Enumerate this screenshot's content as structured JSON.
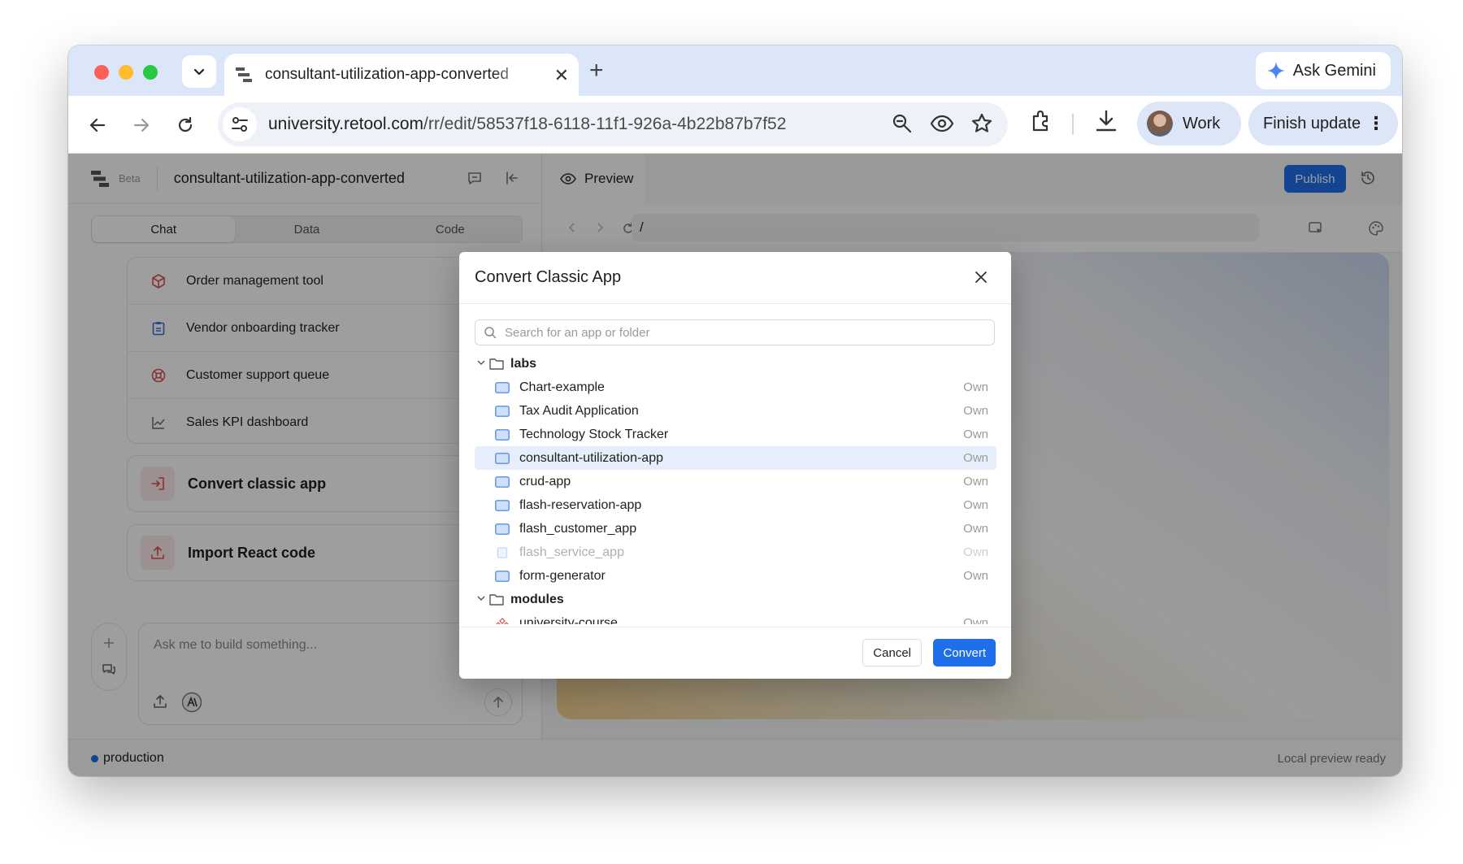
{
  "browser": {
    "tab_title": "consultant-utilization-app-converted",
    "tab_close": "✕",
    "new_tab": "+",
    "ask_gemini": "Ask Gemini",
    "url_host": "university.retool.com",
    "url_path": "/rr/edit/58537f18-6118-11f1-926a-4b22b87b7f52",
    "profile_label": "Work",
    "finish_update": "Finish update",
    "menu_dots": "⋮"
  },
  "app": {
    "beta": "Beta",
    "name": "consultant-utilization-app-converted",
    "tabs": [
      {
        "label": "Chat"
      },
      {
        "label": "Data"
      },
      {
        "label": "Code"
      }
    ],
    "templates": [
      {
        "label": "Order management tool",
        "icon": "cube-icon"
      },
      {
        "label": "Vendor onboarding tracker",
        "icon": "clipboard-icon"
      },
      {
        "label": "Customer support queue",
        "icon": "lifebuoy-icon"
      },
      {
        "label": "Sales KPI dashboard",
        "icon": "chart-line-icon"
      }
    ],
    "actions": [
      {
        "label": "Convert classic app",
        "icon": "import-icon"
      },
      {
        "label": "Import React code",
        "icon": "upload-icon"
      }
    ],
    "chat_placeholder": "Ask me to build something...",
    "preview_label": "Preview",
    "publish": "Publish",
    "preview_path": "/",
    "environment": "production",
    "status": "Local preview ready",
    "accent": "#1f6feb"
  },
  "modal": {
    "title": "Convert Classic App",
    "search_placeholder": "Search for an app or folder",
    "folders": [
      {
        "name": "labs",
        "apps": [
          {
            "name": "Chart-example",
            "perm": "Own",
            "state": "normal"
          },
          {
            "name": "Tax Audit Application",
            "perm": "Own",
            "state": "normal"
          },
          {
            "name": "Technology Stock Tracker",
            "perm": "Own",
            "state": "normal"
          },
          {
            "name": "consultant-utilization-app",
            "perm": "Own",
            "state": "selected"
          },
          {
            "name": "crud-app",
            "perm": "Own",
            "state": "normal"
          },
          {
            "name": "flash-reservation-app",
            "perm": "Own",
            "state": "normal"
          },
          {
            "name": "flash_customer_app",
            "perm": "Own",
            "state": "normal"
          },
          {
            "name": "flash_service_app",
            "perm": "Own",
            "state": "disabled"
          },
          {
            "name": "form-generator",
            "perm": "Own",
            "state": "normal"
          }
        ]
      },
      {
        "name": "modules",
        "apps": [
          {
            "name": "university-course",
            "perm": "Own",
            "state": "module"
          }
        ]
      }
    ],
    "cancel": "Cancel",
    "convert": "Convert"
  }
}
